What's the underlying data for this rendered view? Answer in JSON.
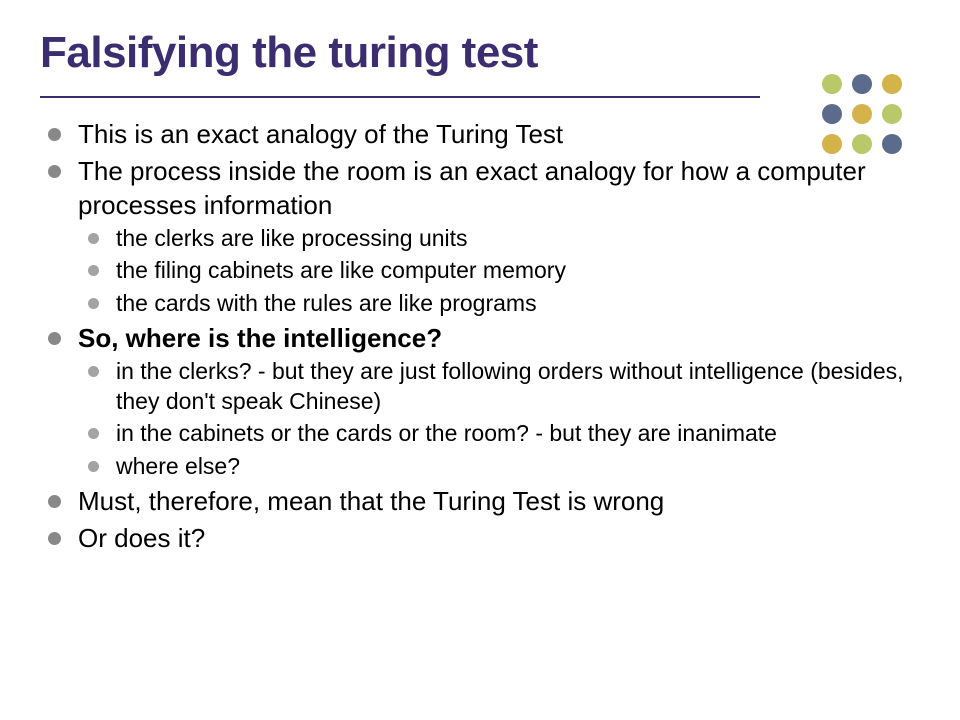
{
  "title": "Falsifying the turing test",
  "bullets": {
    "b1": "This is an exact analogy of the Turing Test",
    "b2": "The process inside the room is an exact analogy for how a computer processes information",
    "b2_1": "the clerks are like processing units",
    "b2_2": "the filing cabinets are like computer memory",
    "b2_3": "the cards with the rules are like programs",
    "b3": "So, where is the intelligence?",
    "b3_1": "in the clerks? - but they are just following orders without intelligence (besides, they don't speak Chinese)",
    "b3_2": "in the cabinets or the cards or the room? - but they are inanimate",
    "b3_3": "where else?",
    "b4": "Must, therefore, mean that the Turing Test is wrong",
    "b5": "Or does it?"
  }
}
